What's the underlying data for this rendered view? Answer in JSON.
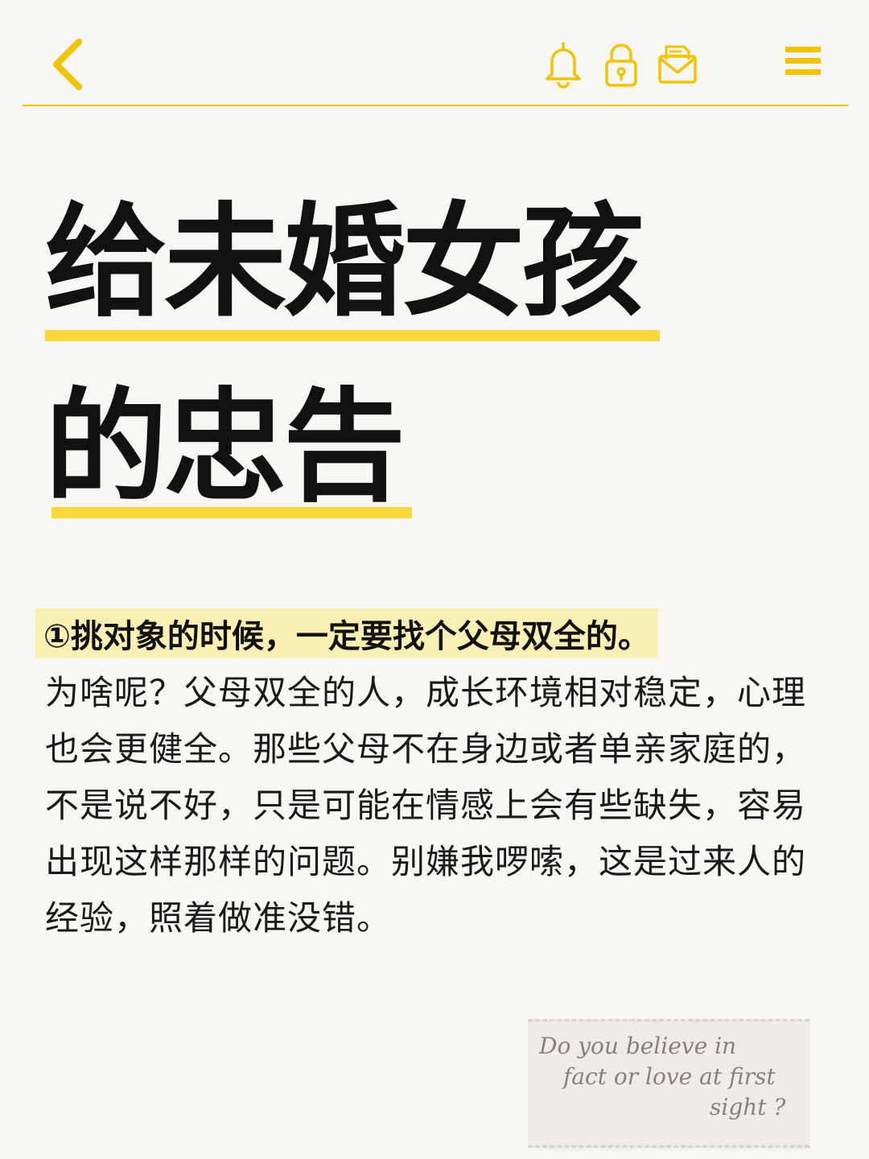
{
  "header": {
    "back_icon": "chevron-left-icon",
    "bell_icon": "bell-icon",
    "lock_icon": "lock-icon",
    "mail_icon": "mail-icon",
    "menu_icon": "menu-icon",
    "accent_color": "#f2c300"
  },
  "title": {
    "line1": "给未婚女孩",
    "line2": "的忠告"
  },
  "tip": {
    "heading": "①挑对象的时候，一定要找个父母双全的。",
    "body": "为啥呢？父母双全的人，成长环境相对稳定，心理也会更健全。那些父母不在身边或者单亲家庭的，不是说不好，只是可能在情感上会有些缺失，容易出现这样那样的问题。别嫌我啰嗦，这是过来人的经验，照着做准没错。"
  },
  "note": {
    "line1": "Do you believe in",
    "line2": "fact or love at first",
    "line3": "sight ?"
  }
}
